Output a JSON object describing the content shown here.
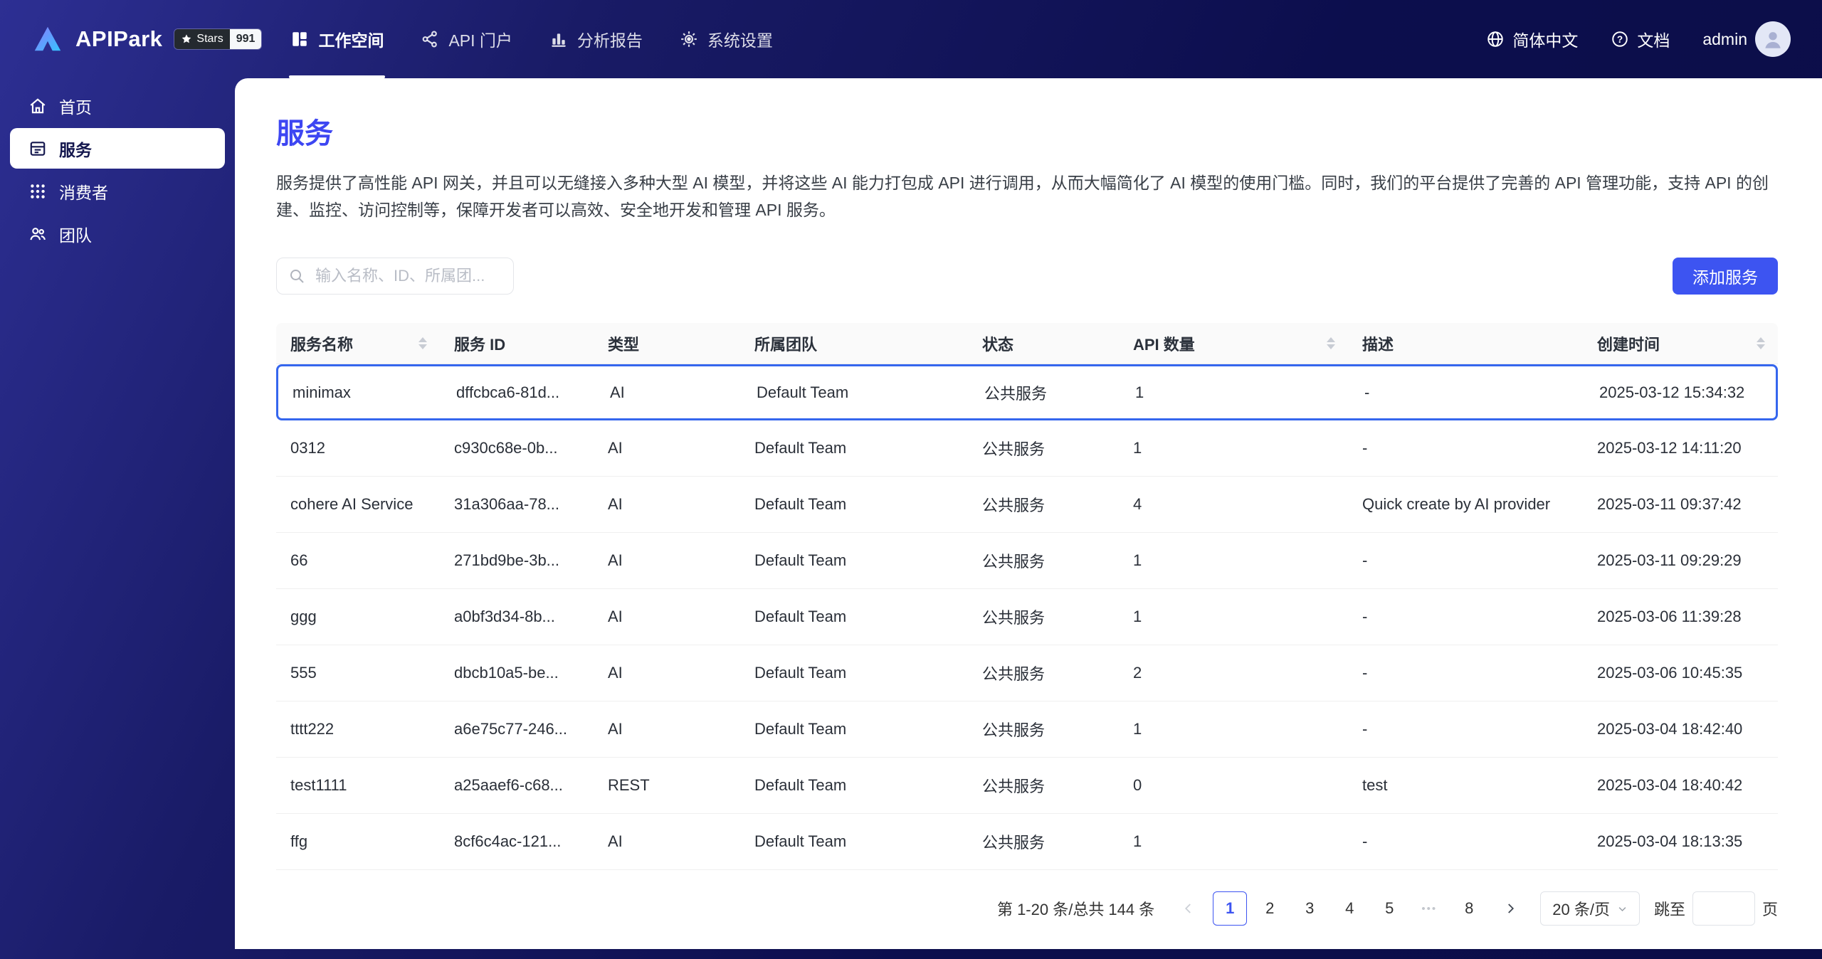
{
  "colors": {
    "accent": "#3d54f1",
    "title": "#3d46f2",
    "topbar_bg": "#0d0f52",
    "highlight_border": "#3566ee"
  },
  "brand": {
    "name": "APIPark",
    "stars_label": "Stars",
    "stars_count": "991"
  },
  "topnav": {
    "items": [
      {
        "label": "工作空间",
        "icon": "workspace-icon",
        "active": true
      },
      {
        "label": "API 门户",
        "icon": "portal-icon",
        "active": false
      },
      {
        "label": "分析报告",
        "icon": "analytics-icon",
        "active": false
      },
      {
        "label": "系统设置",
        "icon": "settings-icon",
        "active": false
      }
    ]
  },
  "topbar_right": {
    "language": "简体中文",
    "docs": "文档",
    "user": "admin"
  },
  "sidebar": {
    "items": [
      {
        "label": "首页",
        "icon": "home-icon",
        "active": false
      },
      {
        "label": "服务",
        "icon": "services-icon",
        "active": true
      },
      {
        "label": "消费者",
        "icon": "consumers-icon",
        "active": false
      },
      {
        "label": "团队",
        "icon": "teams-icon",
        "active": false
      }
    ]
  },
  "page": {
    "title": "服务",
    "description": "服务提供了高性能 API 网关，并且可以无缝接入多种大型 AI 模型，并将这些 AI 能力打包成 API 进行调用，从而大幅简化了 AI 模型的使用门槛。同时，我们的平台提供了完善的 API 管理功能，支持 API 的创建、监控、访问控制等，保障开发者可以高效、安全地开发和管理 API 服务。",
    "search_placeholder": "输入名称、ID、所属团...",
    "add_button": "添加服务"
  },
  "table": {
    "columns": [
      {
        "label": "服务名称",
        "sortable": true
      },
      {
        "label": "服务 ID",
        "sortable": false
      },
      {
        "label": "类型",
        "sortable": false
      },
      {
        "label": "所属团队",
        "sortable": false
      },
      {
        "label": "状态",
        "sortable": false
      },
      {
        "label": "API 数量",
        "sortable": true
      },
      {
        "label": "描述",
        "sortable": false
      },
      {
        "label": "创建时间",
        "sortable": true
      }
    ],
    "rows": [
      {
        "name": "minimax",
        "id": "dffcbca6-81d...",
        "type": "AI",
        "team": "Default Team",
        "status": "公共服务",
        "api_count": "1",
        "desc": "-",
        "created": "2025-03-12 15:34:32",
        "highlighted": true
      },
      {
        "name": "0312",
        "id": "c930c68e-0b...",
        "type": "AI",
        "team": "Default Team",
        "status": "公共服务",
        "api_count": "1",
        "desc": "-",
        "created": "2025-03-12 14:11:20",
        "highlighted": false
      },
      {
        "name": "cohere AI Service",
        "id": "31a306aa-78...",
        "type": "AI",
        "team": "Default Team",
        "status": "公共服务",
        "api_count": "4",
        "desc": "Quick create by AI provider",
        "created": "2025-03-11 09:37:42",
        "highlighted": false
      },
      {
        "name": "66",
        "id": "271bd9be-3b...",
        "type": "AI",
        "team": "Default Team",
        "status": "公共服务",
        "api_count": "1",
        "desc": "-",
        "created": "2025-03-11 09:29:29",
        "highlighted": false
      },
      {
        "name": "ggg",
        "id": "a0bf3d34-8b...",
        "type": "AI",
        "team": "Default Team",
        "status": "公共服务",
        "api_count": "1",
        "desc": "-",
        "created": "2025-03-06 11:39:28",
        "highlighted": false
      },
      {
        "name": "555",
        "id": "dbcb10a5-be...",
        "type": "AI",
        "team": "Default Team",
        "status": "公共服务",
        "api_count": "2",
        "desc": "-",
        "created": "2025-03-06 10:45:35",
        "highlighted": false
      },
      {
        "name": "tttt222",
        "id": "a6e75c77-246...",
        "type": "AI",
        "team": "Default Team",
        "status": "公共服务",
        "api_count": "1",
        "desc": "-",
        "created": "2025-03-04 18:42:40",
        "highlighted": false
      },
      {
        "name": "test1111",
        "id": "a25aaef6-c68...",
        "type": "REST",
        "team": "Default Team",
        "status": "公共服务",
        "api_count": "0",
        "desc": "test",
        "created": "2025-03-04 18:40:42",
        "highlighted": false
      },
      {
        "name": "ffg",
        "id": "8cf6c4ac-121...",
        "type": "AI",
        "team": "Default Team",
        "status": "公共服务",
        "api_count": "1",
        "desc": "-",
        "created": "2025-03-04 18:13:35",
        "highlighted": false
      }
    ]
  },
  "pagination": {
    "summary": "第 1-20 条/总共 144 条",
    "pages": [
      "1",
      "2",
      "3",
      "4",
      "5",
      "•••",
      "8"
    ],
    "active_page": "1",
    "page_size": "20 条/页",
    "jump_label": "跳至",
    "jump_suffix": "页"
  }
}
